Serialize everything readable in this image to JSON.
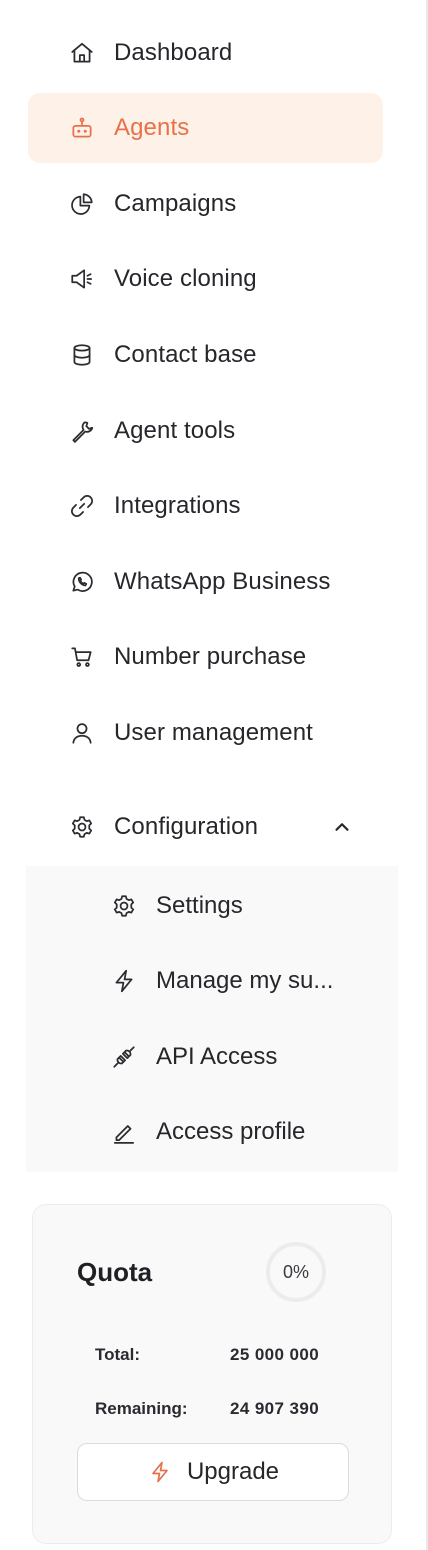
{
  "nav": {
    "items": [
      {
        "label": "Dashboard",
        "icon": "home-icon"
      },
      {
        "label": "Agents",
        "icon": "robot-icon",
        "active": true
      },
      {
        "label": "Campaigns",
        "icon": "pie-chart-icon"
      },
      {
        "label": "Voice cloning",
        "icon": "megaphone-icon"
      },
      {
        "label": "Contact base",
        "icon": "database-icon"
      },
      {
        "label": "Agent tools",
        "icon": "wrench-icon"
      },
      {
        "label": "Integrations",
        "icon": "link-icon"
      },
      {
        "label": "WhatsApp Business",
        "icon": "whatsapp-icon"
      },
      {
        "label": "Number purchase",
        "icon": "cart-icon"
      },
      {
        "label": "User management",
        "icon": "user-icon"
      }
    ],
    "configuration": {
      "label": "Configuration",
      "icon": "gear-icon",
      "expanded": true,
      "subitems": [
        {
          "label": "Settings",
          "icon": "gear-icon"
        },
        {
          "label": "Manage my su...",
          "icon": "lightning-icon"
        },
        {
          "label": "API Access",
          "icon": "plug-icon"
        },
        {
          "label": "Access profile",
          "icon": "pencil-icon"
        }
      ]
    }
  },
  "quota": {
    "title": "Quota",
    "percent_label": "0%",
    "percent": 0,
    "total_label": "Total:",
    "total_value": "25 000 000",
    "remaining_label": "Remaining:",
    "remaining_value": "24 907 390",
    "upgrade_label": "Upgrade"
  },
  "colors": {
    "accent": "#e8714a",
    "active_bg": "#fdf1e8",
    "panel_bg": "#f9f9fa",
    "text": "#26262b"
  }
}
